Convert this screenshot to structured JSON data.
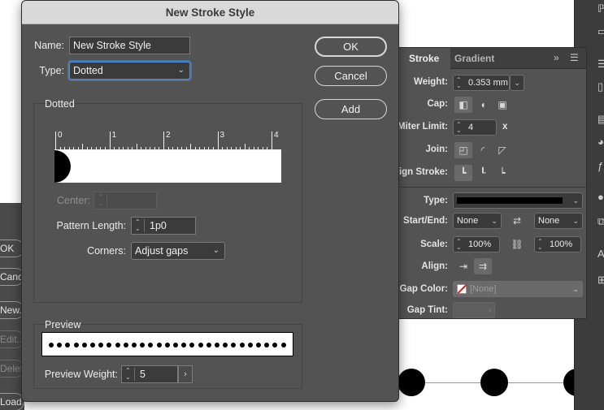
{
  "dialog": {
    "title": "New Stroke Style",
    "name_label": "Name:",
    "name_value": "New Stroke Style",
    "type_label": "Type:",
    "type_value": "Dotted",
    "buttons": {
      "ok": "OK",
      "cancel": "Cancel",
      "add": "Add"
    },
    "dotted": {
      "group_title": "Dotted",
      "ruler_numbers": [
        "0",
        "1",
        "2",
        "3",
        "4"
      ],
      "center_label": "Center:",
      "center_value": "",
      "pattern_length_label": "Pattern Length:",
      "pattern_length_value": "1p0",
      "corners_label": "Corners:",
      "corners_value": "Adjust gaps"
    },
    "preview": {
      "group_title": "Preview",
      "weight_label": "Preview Weight:",
      "weight_value": "5"
    }
  },
  "stroke_panel": {
    "tabs": [
      "Stroke",
      "Gradient"
    ],
    "weight_label": "Weight:",
    "weight_value": "0.353 mm",
    "cap_label": "Cap:",
    "miter_label": "Miter Limit:",
    "miter_value": "4",
    "miter_unit": "x",
    "join_label": "Join:",
    "align_stroke_label": "Align Stroke:",
    "type_label": "Type:",
    "start_end_label": "Start/End:",
    "start_value": "None",
    "end_value": "None",
    "scale_label": "Scale:",
    "scale_start": "100%",
    "scale_end": "100%",
    "align_label": "Align:",
    "gap_color_label": "Gap Color:",
    "gap_color_value": "[None]",
    "gap_tint_label": "Gap Tint:"
  },
  "left_panel": {
    "buttons": [
      "OK",
      "Cancel",
      "New...",
      "Edit...",
      "Delete",
      "Load..."
    ]
  },
  "colors": {
    "dialog_bg": "#535353",
    "panel_bg": "#535353",
    "focus_ring": "#4c8fe0",
    "pattern_fill": "#000000"
  }
}
